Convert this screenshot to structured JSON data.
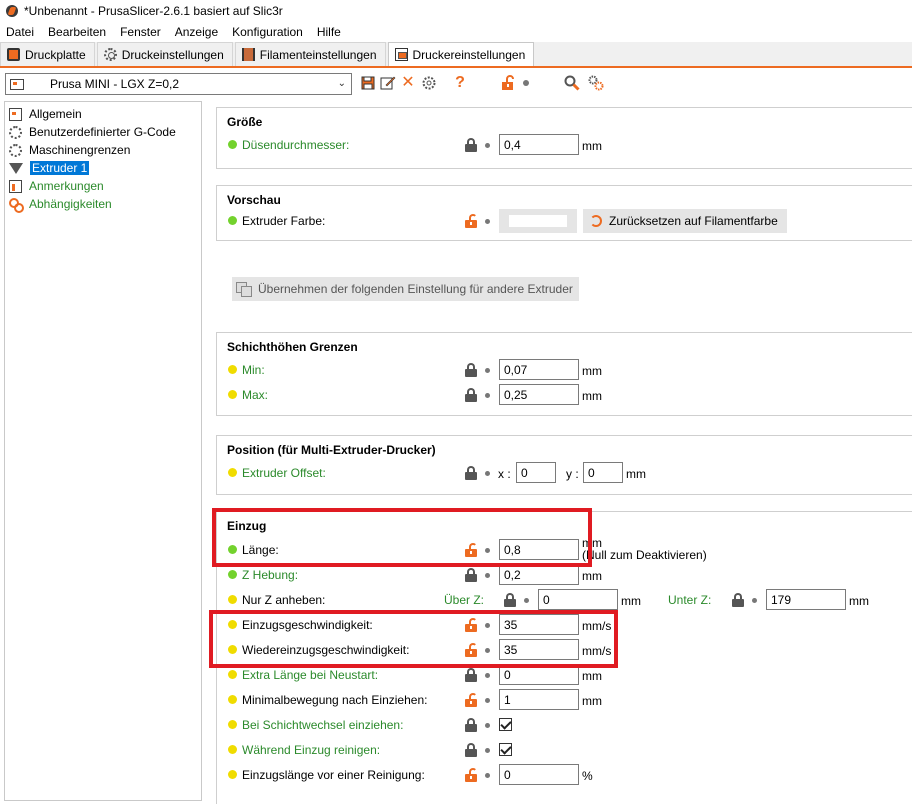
{
  "window": {
    "title": "*Unbenannt - PrusaSlicer-2.6.1 basiert auf Slic3r"
  },
  "menu": [
    "Datei",
    "Bearbeiten",
    "Fenster",
    "Anzeige",
    "Konfiguration",
    "Hilfe"
  ],
  "tabs": [
    "Druckplatte",
    "Druckeinstellungen",
    "Filamenteinstellungen",
    "Druckereinstellungen"
  ],
  "active_tab": "Druckereinstellungen",
  "preset": {
    "name": "Prusa MINI - LGX  Z=0,2",
    "help_glyph": "?",
    "delete_glyph": "✕"
  },
  "sidebar": {
    "items": [
      "Allgemein",
      "Benutzerdefinierter G-Code",
      "Maschinengrenzen",
      "Extruder 1",
      "Anmerkungen",
      "Abhängigkeiten"
    ],
    "selected": "Extruder 1"
  },
  "groesse": {
    "title": "Größe",
    "nozzle_label": "Düsendurchmesser:",
    "nozzle_value": "0,4",
    "nozzle_unit": "mm"
  },
  "vorschau": {
    "title": "Vorschau",
    "color_label": "Extruder Farbe:",
    "reset_label": "Zurücksetzen auf Filamentfarbe"
  },
  "copy_button": "Übernehmen der folgenden Einstellung für andere Extruder",
  "layer_limits": {
    "title": "Schichthöhen Grenzen",
    "min_label": "Min:",
    "min_value": "0,07",
    "min_unit": "mm",
    "max_label": "Max:",
    "max_value": "0,25",
    "max_unit": "mm"
  },
  "position": {
    "title": "Position (für Multi-Extruder-Drucker)",
    "offset_label": "Extruder Offset:",
    "x_label": "x :",
    "x_value": "0",
    "y_label": "y :",
    "y_value": "0",
    "unit": "mm"
  },
  "einzug": {
    "title": "Einzug",
    "length_label": "Länge:",
    "length_value": "0,8",
    "length_unit": "mm",
    "length_note": "(Null zum Deaktivieren)",
    "zhop_label": "Z Hebung:",
    "zhop_value": "0,2",
    "zhop_unit": "mm",
    "onlyz_label": "Nur Z anheben:",
    "above_label": "Über Z:",
    "above_value": "0",
    "above_unit": "mm",
    "below_label": "Unter Z:",
    "below_value": "179",
    "below_unit": "mm",
    "speed_label": "Einzugsgeschwindigkeit:",
    "speed_value": "35",
    "speed_unit": "mm/s",
    "despeed_label": "Wiedereinzugsgeschwindigkeit:",
    "despeed_value": "35",
    "despeed_unit": "mm/s",
    "extra_label": "Extra Länge bei Neustart:",
    "extra_value": "0",
    "extra_unit": "mm",
    "minmove_label": "Minimalbewegung nach Einziehen:",
    "minmove_value": "1",
    "minmove_unit": "mm",
    "layerchange_label": "Bei Schichtwechsel einziehen:",
    "layerchange_checked": true,
    "wipe_label": "Während Einzug reinigen:",
    "wipe_checked": true,
    "beforewipe_label": "Einzugslänge vor einer Reinigung:",
    "beforewipe_value": "0",
    "beforewipe_unit": "%"
  },
  "colors": {
    "accent": "#ed6b21",
    "highlight": "#e01b22",
    "selection": "#0078d7",
    "label_green": "#2b8a2b"
  }
}
